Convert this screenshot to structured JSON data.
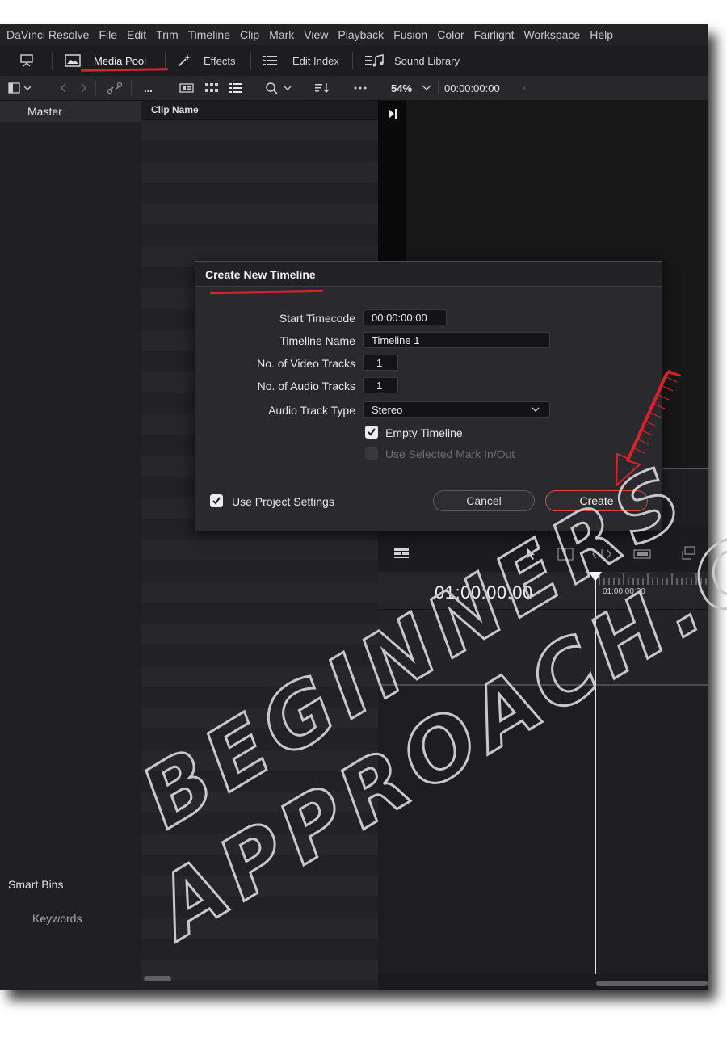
{
  "menubar": {
    "items": [
      "DaVinci Resolve",
      "File",
      "Edit",
      "Trim",
      "Timeline",
      "Clip",
      "Mark",
      "View",
      "Playback",
      "Fusion",
      "Color",
      "Fairlight",
      "Workspace",
      "Help"
    ]
  },
  "toolbar": {
    "media_pool": "Media Pool",
    "effects": "Effects",
    "edit_index": "Edit Index",
    "sound_library": "Sound Library"
  },
  "secondary_bar": {
    "more": "...",
    "zoom": "54%",
    "timecode": "00:00:00:00"
  },
  "bins": {
    "master": "Master",
    "smart_bins": "Smart Bins",
    "keywords": "Keywords"
  },
  "clip_list": {
    "header": "Clip Name"
  },
  "timeline": {
    "timecode": "01:00:00:00",
    "ruler_label": "01:00:00:00"
  },
  "dialog": {
    "title": "Create New Timeline",
    "fields": {
      "start_timecode": {
        "label": "Start Timecode",
        "value": "00:00:00:00"
      },
      "timeline_name": {
        "label": "Timeline Name",
        "value": "Timeline 1"
      },
      "video_tracks": {
        "label": "No. of Video Tracks",
        "value": "1"
      },
      "audio_tracks": {
        "label": "No. of Audio Tracks",
        "value": "1"
      },
      "audio_track_type": {
        "label": "Audio Track Type",
        "value": "Stereo"
      }
    },
    "empty_timeline": {
      "label": "Empty Timeline",
      "checked": true
    },
    "use_selected_mark": {
      "label": "Use Selected Mark In/Out",
      "checked": false,
      "disabled": true
    },
    "use_project_settings": {
      "label": "Use Project Settings",
      "checked": true
    },
    "cancel_label": "Cancel",
    "create_label": "Create"
  },
  "watermark": {
    "line1": "BEGINNERS",
    "line2": "APPROACH.COM"
  },
  "colors": {
    "annotation_red": "#d8232a",
    "create_border": "#e0473b"
  }
}
